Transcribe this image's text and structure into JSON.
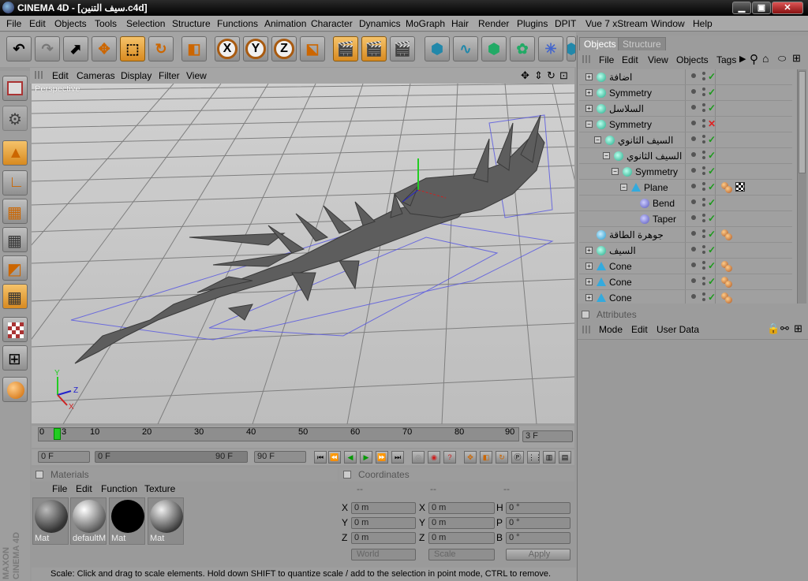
{
  "window": {
    "title": "CINEMA 4D - [سيف التنين.c4d]",
    "minimize": "▁",
    "maximize": "▣",
    "close": "✕"
  },
  "menu": [
    "File",
    "Edit",
    "Objects",
    "Tools",
    "Selection",
    "Structure",
    "Functions",
    "Animation",
    "Character",
    "Dynamics",
    "MoGraph",
    "Hair",
    "Render",
    "Plugins",
    "DPIT",
    "Vue 7 xStream",
    "Window",
    "Help"
  ],
  "toolbar": {
    "x_label": "X",
    "y_label": "Y",
    "z_label": "Z"
  },
  "viewport": {
    "menu": [
      "Edit",
      "Cameras",
      "Display",
      "Filter",
      "View"
    ],
    "label": "Perspective",
    "axis_labels": {
      "y": "Y",
      "z": "Z",
      "x": "X"
    }
  },
  "timeline": {
    "ticks": [
      "0",
      "10",
      "20",
      "30",
      "40",
      "50",
      "60",
      "70",
      "80",
      "90"
    ],
    "current": "3",
    "frame_field": "3 F"
  },
  "playbar": {
    "start": "0 F",
    "range_start": "0 F",
    "range_end": "90 F",
    "end": "90 F"
  },
  "materials": {
    "title": "Materials",
    "menu": [
      "File",
      "Edit",
      "Function",
      "Texture"
    ],
    "items": [
      {
        "name": "Mat"
      },
      {
        "name": "defaultM"
      },
      {
        "name": "Mat"
      },
      {
        "name": "Mat"
      }
    ]
  },
  "coordinates": {
    "title": "Coordinates",
    "dashes": [
      "--",
      "--",
      "--"
    ],
    "rows": [
      {
        "l1": "X",
        "v1": "0 m",
        "l2": "X",
        "v2": "0 m",
        "l3": "H",
        "v3": "0 °"
      },
      {
        "l1": "Y",
        "v1": "0 m",
        "l2": "Y",
        "v2": "0 m",
        "l3": "P",
        "v3": "0 °"
      },
      {
        "l1": "Z",
        "v1": "0 m",
        "l2": "Z",
        "v2": "0 m",
        "l3": "B",
        "v3": "0 °"
      }
    ],
    "world": "World",
    "scale": "Scale",
    "apply": "Apply"
  },
  "status": "Scale: Click and drag to scale elements. Hold down SHIFT to quantize scale / add to the selection in point mode, CTRL to remove.",
  "objects_panel": {
    "tabs": [
      "Objects",
      "Structure"
    ],
    "menu": [
      "File",
      "Edit",
      "View",
      "Objects",
      "Tags"
    ],
    "rows": [
      {
        "name": "اضافة",
        "indent": 0,
        "exp": "+",
        "icon": "null",
        "check": "✓",
        "tags": []
      },
      {
        "name": "Symmetry",
        "indent": 0,
        "exp": "+",
        "icon": "null",
        "check": "✓",
        "tags": []
      },
      {
        "name": "السلاسل",
        "indent": 0,
        "exp": "+",
        "icon": "lod",
        "check": "✓",
        "tags": []
      },
      {
        "name": "Symmetry",
        "indent": 0,
        "exp": "−",
        "icon": "null",
        "check": "✕",
        "tags": []
      },
      {
        "name": "السيف الثانوي",
        "indent": 1,
        "exp": "−",
        "icon": "null",
        "check": "✓",
        "tags": []
      },
      {
        "name": "السيف الثانوي",
        "indent": 2,
        "exp": "−",
        "icon": "null",
        "check": "✓",
        "tags": []
      },
      {
        "name": "Symmetry",
        "indent": 3,
        "exp": "−",
        "icon": "null",
        "check": "✓",
        "tags": []
      },
      {
        "name": "Plane",
        "indent": 4,
        "exp": "−",
        "icon": "tri",
        "check": "✓",
        "tags": [
          "ball",
          "chk"
        ]
      },
      {
        "name": "Bend",
        "indent": 5,
        "exp": "",
        "icon": "def",
        "check": "✓",
        "tags": []
      },
      {
        "name": "Taper",
        "indent": 5,
        "exp": "",
        "icon": "def",
        "check": "✓",
        "tags": []
      },
      {
        "name": "جوهرة الطاقة",
        "indent": 0,
        "exp": "",
        "icon": "sph",
        "check": "✓",
        "tags": [
          "ball"
        ]
      },
      {
        "name": "السيف",
        "indent": 0,
        "exp": "+",
        "icon": "null",
        "check": "✓",
        "tags": []
      },
      {
        "name": "Cone",
        "indent": 0,
        "exp": "+",
        "icon": "tri",
        "check": "✓",
        "tags": [
          "ball"
        ]
      },
      {
        "name": "Cone",
        "indent": 0,
        "exp": "+",
        "icon": "tri",
        "check": "✓",
        "tags": [
          "ball"
        ]
      },
      {
        "name": "Cone",
        "indent": 0,
        "exp": "+",
        "icon": "tri",
        "check": "✓",
        "tags": [
          "ball"
        ]
      }
    ]
  },
  "attributes_panel": {
    "title": "Attributes",
    "menu": [
      "Mode",
      "Edit",
      "User Data"
    ]
  }
}
